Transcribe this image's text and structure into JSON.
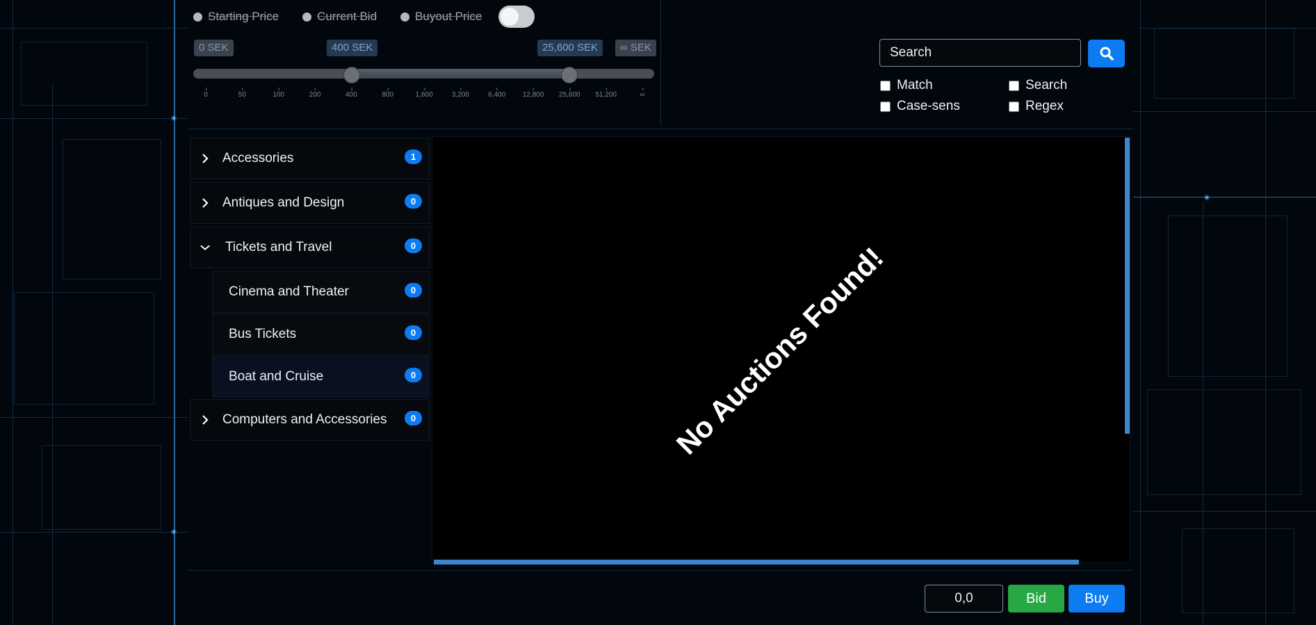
{
  "filters": {
    "price_types": [
      {
        "label": "Starting Price"
      },
      {
        "label": "Current Bid"
      },
      {
        "label": "Buyout Price"
      }
    ],
    "toggle_on": false
  },
  "price_range": {
    "min_label": "0 SEK",
    "low_label": "400 SEK",
    "high_label": "25,600 SEK",
    "max_label": "∞ SEK",
    "low_value": 400,
    "high_value": 25600,
    "ticks": [
      "0",
      "50",
      "100",
      "200",
      "400",
      "800",
      "1,600",
      "3,200",
      "6,400",
      "12,800",
      "25,600",
      "51,200",
      "∞"
    ]
  },
  "search": {
    "placeholder": "Search",
    "options": {
      "match": "Match",
      "search": "Search",
      "case_sensitive": "Case-sens",
      "regex": "Regex"
    }
  },
  "categories": [
    {
      "label": "Accessories",
      "count": "1",
      "expanded": false
    },
    {
      "label": "Antiques and Design",
      "count": "0",
      "expanded": false
    },
    {
      "label": "Tickets and Travel",
      "count": "0",
      "expanded": true,
      "children": [
        {
          "label": "Cinema and Theater",
          "count": "0"
        },
        {
          "label": "Bus Tickets",
          "count": "0"
        },
        {
          "label": "Boat and Cruise",
          "count": "0",
          "selected": true
        }
      ]
    },
    {
      "label": "Computers and Accessories",
      "count": "0",
      "expanded": false
    }
  ],
  "results": {
    "empty_message": "No Auctions Found!"
  },
  "actions": {
    "bid_amount": "0,0",
    "bid_label": "Bid",
    "buy_label": "Buy"
  },
  "colors": {
    "accent": "#0d7cf2",
    "bid": "#28a745",
    "scrollbar": "#3f86cc"
  }
}
